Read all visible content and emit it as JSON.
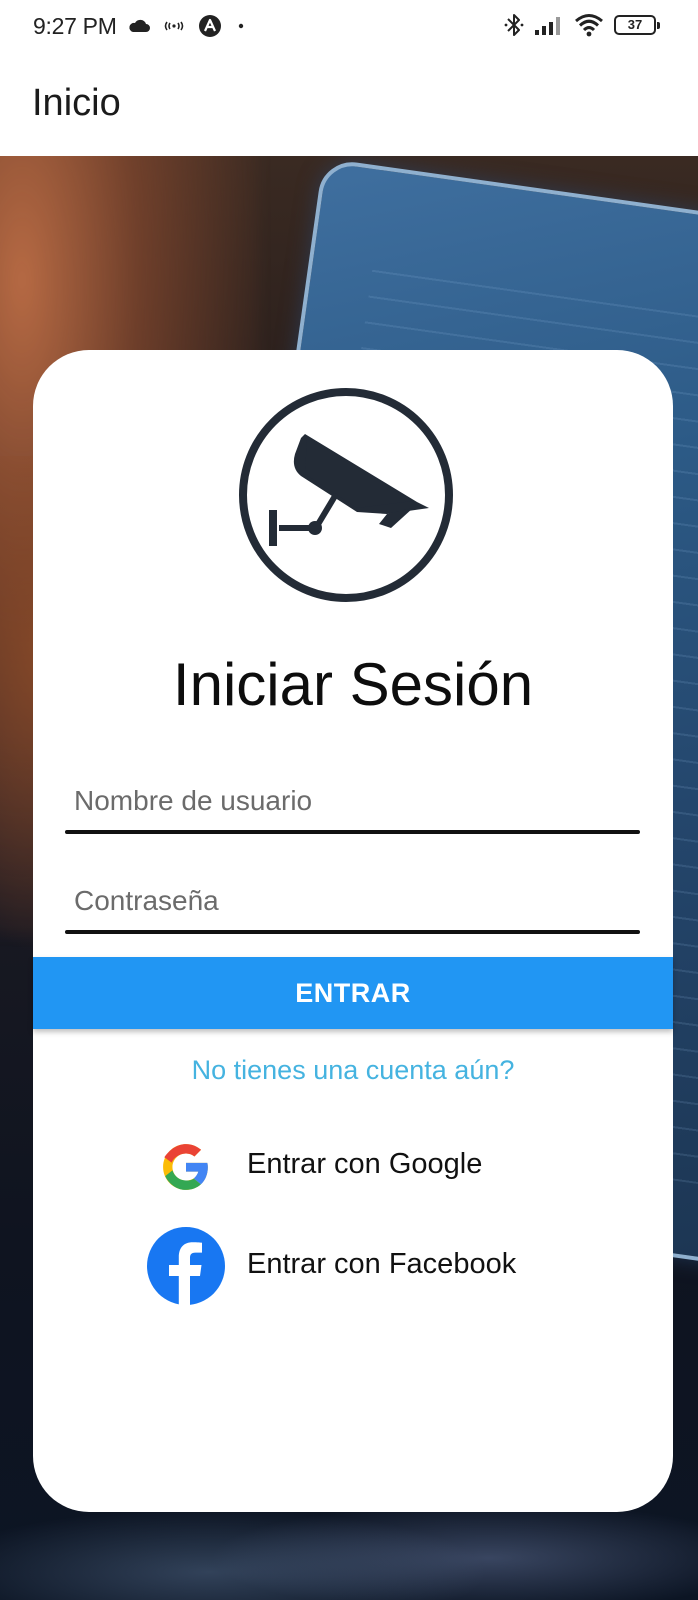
{
  "status_bar": {
    "time": "9:27 PM",
    "battery": "37",
    "icons": [
      "cloud-icon",
      "nfc-icon",
      "app-a-icon",
      "dot-icon",
      "bluetooth-icon",
      "signal-icon",
      "wifi-icon",
      "battery-icon"
    ]
  },
  "app_bar": {
    "title": "Inicio"
  },
  "login": {
    "title": "Iniciar Sesión",
    "username_placeholder": "Nombre de usuario",
    "username_value": "",
    "password_placeholder": "Contraseña",
    "password_value": "",
    "enter_label": "ENTRAR",
    "register_link": "No tienes una cuenta aún?",
    "google_label": "Entrar con Google",
    "facebook_label": "Entrar con Facebook",
    "logo_icon": "security-camera-icon"
  },
  "colors": {
    "primary": "#2196f3",
    "link": "#45b3e0",
    "facebook": "#1877f2",
    "logo": "#232b36"
  }
}
